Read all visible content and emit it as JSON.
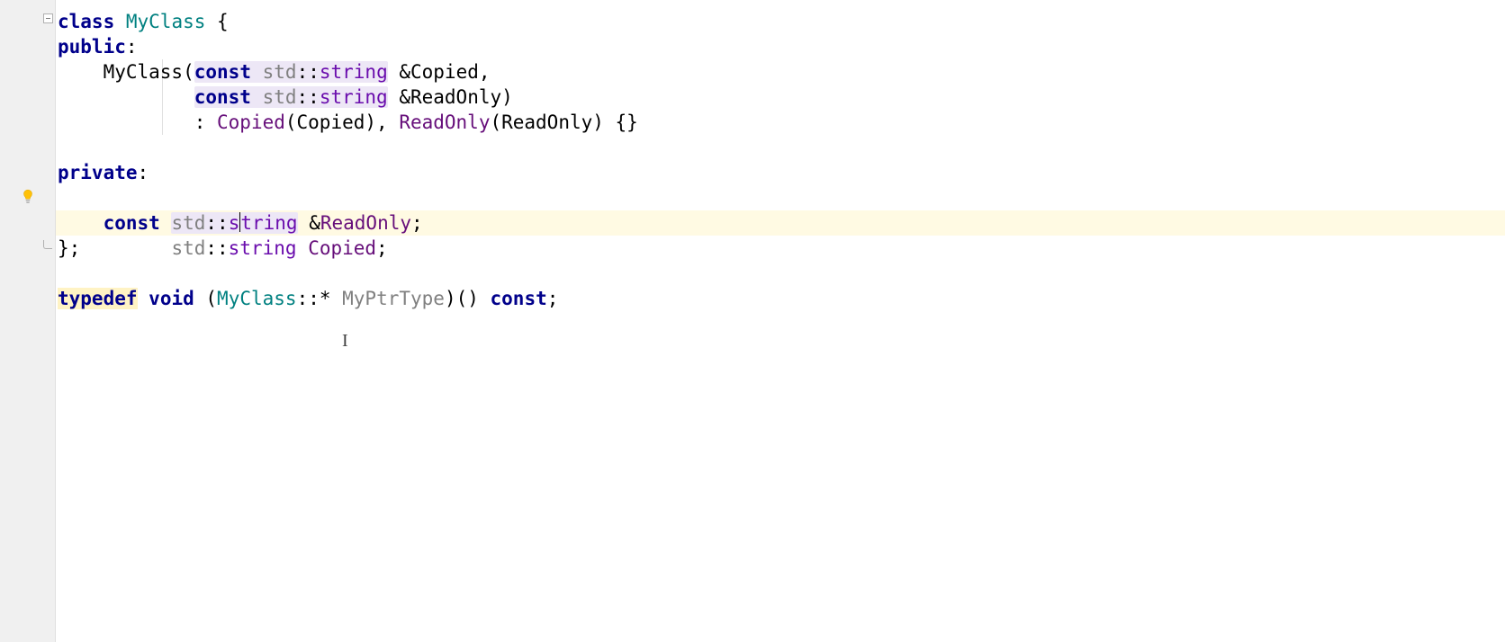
{
  "code": {
    "l1": {
      "kw_class": "class",
      "cls": "MyClass",
      "brace": " {"
    },
    "l2": {
      "kw_public": "public",
      "colon": ":"
    },
    "l3": {
      "ctor": "MyClass",
      "open": "(",
      "kw_const": "const",
      "ns": "std",
      "dcolon": "::",
      "type": "string",
      "amp_param": " &Copied,",
      "sp": "    "
    },
    "l4": {
      "pad": "            ",
      "kw_const": "const",
      "ns": "std",
      "dcolon": "::",
      "type": "string",
      "amp_param": " &ReadOnly)"
    },
    "l5": {
      "pad": "            ",
      "colon": ": ",
      "m1": "Copied",
      "p1": "(Copied), ",
      "m2": "ReadOnly",
      "p2": "(ReadOnly) {}"
    },
    "l7": {
      "kw_private": "private",
      "colon": ":"
    },
    "l8": {
      "pad": "    ",
      "ns": "std",
      "dcolon": "::",
      "type": "string",
      "sp": " ",
      "name": "Copied",
      "semi": ";"
    },
    "l9": {
      "pad": "    ",
      "kw_const": "const",
      "ns": "std",
      "dcolon": "::",
      "type_a": "s",
      "type_b": "tring",
      "amp": " &",
      "name": "ReadOnly",
      "semi": ";"
    },
    "l10": {
      "close": "};"
    },
    "l12": {
      "kw_typedef": "typedef",
      "sp1": " ",
      "kw_void": "void",
      "sp2": " (",
      "cls": "MyClass",
      "dcolon_star": "::* ",
      "ptr": "MyPtrType",
      "close": ")() ",
      "kw_const": "const",
      "semi": ";"
    }
  },
  "icons": {
    "bulb": "lightbulb-icon",
    "fold_open": "fold-open-icon",
    "fold_end": "fold-end-icon"
  },
  "colors": {
    "keyword": "#00008b",
    "type_teal": "#008080",
    "member_purple": "#660e7a",
    "current_line_bg": "#fffae3",
    "usage_highlight_bg": "#ede7f6"
  }
}
